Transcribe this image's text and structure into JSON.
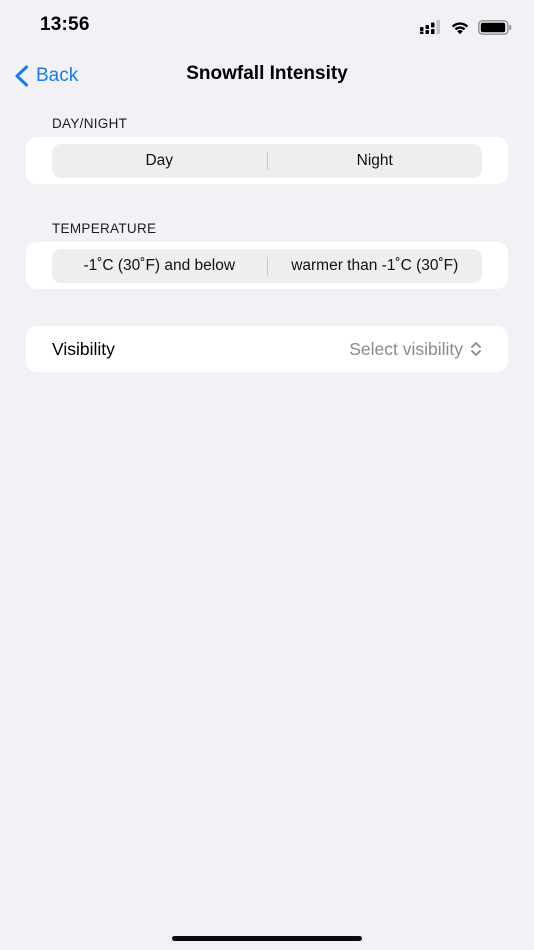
{
  "status_bar": {
    "time": "13:56",
    "icons": [
      "signal-icon",
      "wifi-icon",
      "battery-icon"
    ]
  },
  "nav": {
    "back_label": "Back",
    "title": "Snowfall Intensity",
    "accent_color": "#1a7af0"
  },
  "day_night": {
    "header": "DAY/NIGHT",
    "options": [
      "Day",
      "Night"
    ]
  },
  "temperature": {
    "header": "TEMPERATURE",
    "options": [
      "-1˚C (30˚F) and below",
      "warmer than -1˚C (30˚F)"
    ]
  },
  "visibility": {
    "label": "Visibility",
    "value": "Select visibility",
    "icon": "chevron-up-down-icon"
  }
}
